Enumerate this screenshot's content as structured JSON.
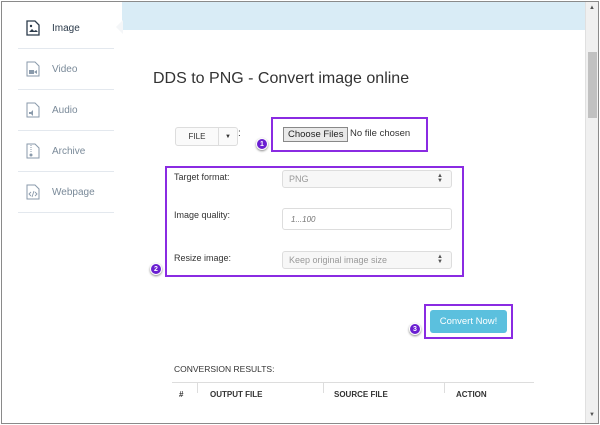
{
  "sidebar": {
    "items": [
      {
        "label": "Image",
        "icon": "image-file-icon",
        "active": true
      },
      {
        "label": "Video",
        "icon": "video-file-icon"
      },
      {
        "label": "Audio",
        "icon": "audio-file-icon"
      },
      {
        "label": "Archive",
        "icon": "archive-file-icon"
      },
      {
        "label": "Webpage",
        "icon": "code-file-icon"
      }
    ]
  },
  "main": {
    "title": "DDS to PNG - Convert image online",
    "file_source": "FILE",
    "colon": ":",
    "choose_files": "Choose Files",
    "no_file": "No file chosen",
    "target_format_label": "Target format:",
    "target_format_value": "PNG",
    "quality_label": "Image quality:",
    "quality_placeholder": "1...100",
    "resize_label": "Resize image:",
    "resize_value": "Keep original image size",
    "convert": "Convert Now!",
    "results_title": "CONVERSION RESULTS:",
    "columns": [
      "#",
      "OUTPUT FILE",
      "SOURCE FILE",
      "ACTION"
    ]
  },
  "annotations": {
    "steps": [
      "1",
      "2",
      "3"
    ],
    "color": "#8a2be2"
  },
  "colors": {
    "accent": "#5bc0de",
    "highlight": "#8a2be2"
  }
}
